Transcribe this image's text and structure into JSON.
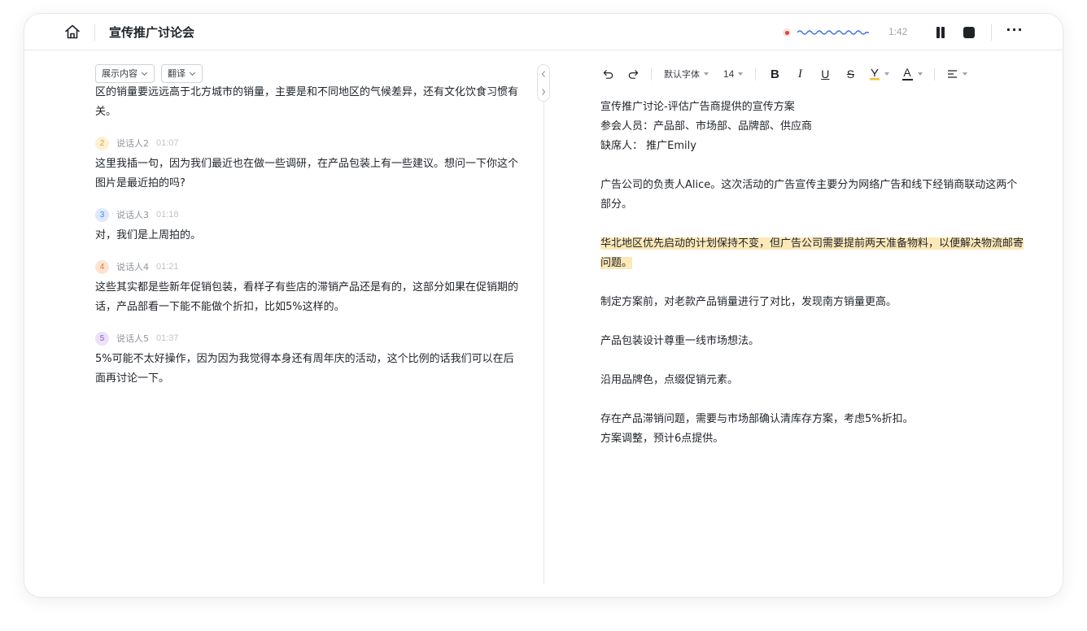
{
  "header": {
    "title": "宣传推广讨论会",
    "timer": "1:42",
    "more_label": "···"
  },
  "transcript_controls": {
    "show_content_label": "展示内容",
    "translate_label": "翻译"
  },
  "transcript": {
    "partial_text": "区的销量要远远高于北方城市的销量，主要是和不同地区的气候差异，还有文化饮食习惯有关。",
    "segments": [
      {
        "num": "2",
        "speaker": "说话人2",
        "time": "01:07",
        "text": "这里我插一句，因为我们最近也在做一些调研，在产品包装上有一些建议。想问一下你这个图片是最近拍的吗?",
        "color": "#f5b13d",
        "bg": "#fdf1d6"
      },
      {
        "num": "3",
        "speaker": "说话人3",
        "time": "01:18",
        "text": "对，我们是上周拍的。",
        "color": "#3f8ee8",
        "bg": "#dde9fb"
      },
      {
        "num": "4",
        "speaker": "说话人4",
        "time": "01:21",
        "text": "这些其实都是些新年促销包装，看样子有些店的滞销产品还是有的，这部分如果在促销期的话，产品部看一下能不能做个折扣，比如5%这样的。",
        "color": "#ea7b2f",
        "bg": "#fde4d2"
      },
      {
        "num": "5",
        "speaker": "说话人5",
        "time": "01:37",
        "text": "5%可能不太好操作，因为因为我觉得本身还有周年庆的活动，这个比例的话我们可以在后面再讨论一下。",
        "color": "#8b5cd6",
        "bg": "#ebe1f8"
      }
    ]
  },
  "toolbar": {
    "font_label": "默认字体",
    "size_label": "14",
    "bold": "B",
    "italic": "I",
    "underline": "U",
    "strike": "S",
    "text_color": "A",
    "highlight_color": "#f2c233",
    "font_color_bar": "#1f2329"
  },
  "document": {
    "lines": [
      "宣传推广讨论-评估广告商提供的宣传方案",
      "参会人员：产品部、市场部、品牌部、供应商",
      "缺席人： 推广Emily",
      "",
      "广告公司的负责人Alice。这次活动的广告宣传主要分为网络广告和线下经销商联动这两个部分。",
      "",
      "华北地区优先启动的计划保持不变，但广告公司需要提前两天准备物料，以便解决物流邮寄问题。",
      "",
      "制定方案前，对老款产品销量进行了对比，发现南方销量更高。",
      "",
      "产品包装设计尊重一线市场想法。",
      "",
      "沿用品牌色，点缀促销元素。",
      "",
      "存在产品滞销问题，需要与市场部确认清库存方案，考虑5%折扣。",
      "方案调整，预计6点提供。"
    ],
    "highlight_color": "#fde8b8"
  },
  "recording": {
    "dot_color": "#e5413a",
    "wave_color": "#3b6fe0"
  }
}
